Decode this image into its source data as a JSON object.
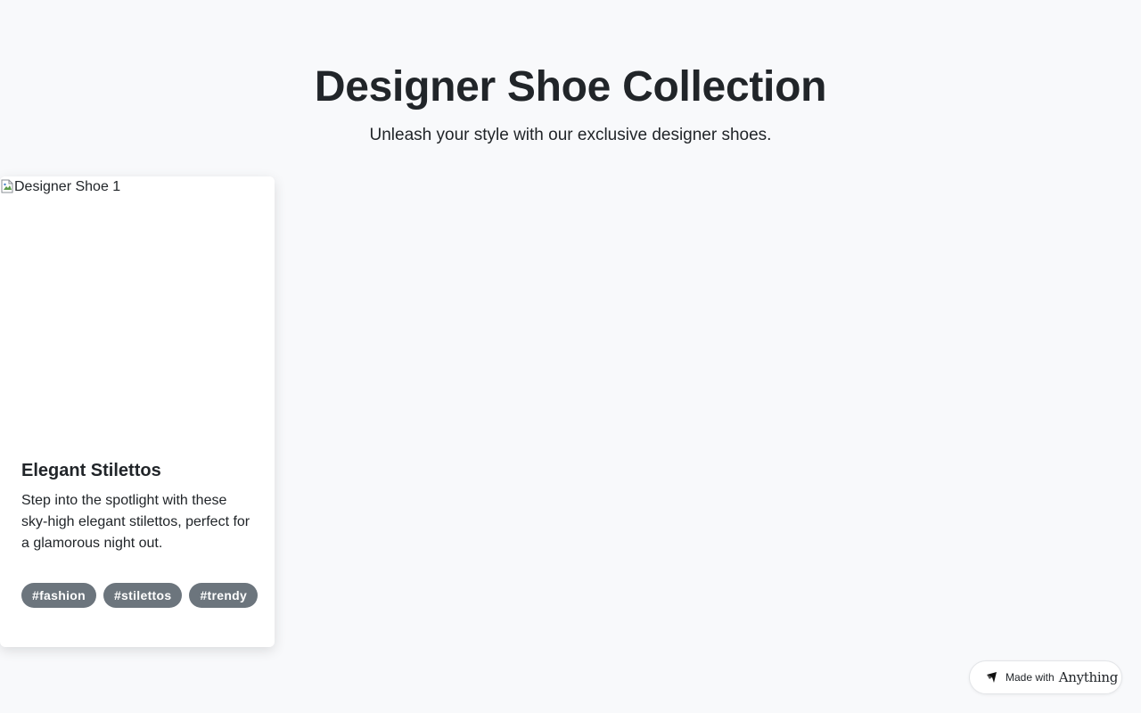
{
  "hero": {
    "title": "Designer Shoe Collection",
    "subtitle": "Unleash your style with our exclusive designer shoes."
  },
  "products": [
    {
      "image_alt": "Designer Shoe 1",
      "title": "Elegant Stilettos",
      "description": "Step into the spotlight with these sky-high elegant stilettos, perfect for a glamorous night out.",
      "tags": [
        "#fashion",
        "#stilettos",
        "#trendy"
      ]
    }
  ],
  "badge": {
    "prefix": "Made with",
    "brand": "Anything",
    "icon": "anything-logo-icon"
  },
  "colors": {
    "background": "#f8f9fb",
    "text": "#212529",
    "tag_background": "#6c757d",
    "tag_text": "#ffffff"
  }
}
